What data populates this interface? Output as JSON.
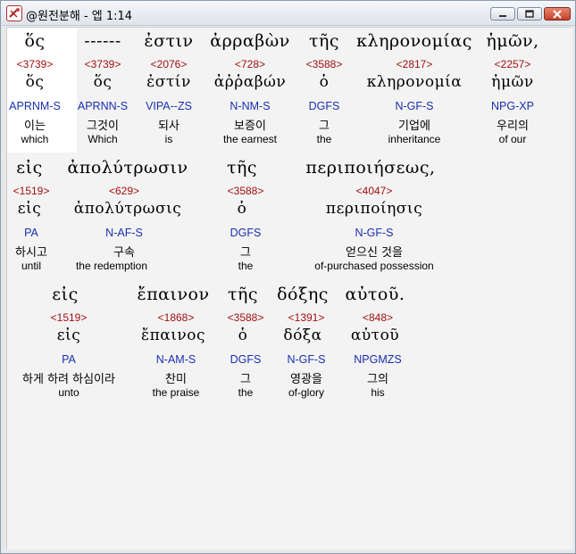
{
  "window": {
    "title": "@원전분해 - 엡 1:14"
  },
  "rows": [
    {
      "words": [
        {
          "greek": "ὅς",
          "strong": "<3739>",
          "lemma": "ὅς",
          "parse": "APRNM-S",
          "korean": "이는",
          "english": "which"
        },
        {
          "greek": "------",
          "strong": "<3739>",
          "lemma": "ὅς",
          "parse": "APRNN-S",
          "korean": "그것이",
          "english": "Which"
        },
        {
          "greek": "ἐστιν",
          "strong": "<2076>",
          "lemma": "ἐστίν",
          "parse": "VIPA--ZS",
          "korean": "되사",
          "english": "is"
        },
        {
          "greek": "ἀρραβὼν",
          "strong": "<728>",
          "lemma": "ἀῤῥαβών",
          "parse": "N-NM-S",
          "korean": "보증이",
          "english": "the earnest"
        },
        {
          "greek": "τῆς",
          "strong": "<3588>",
          "lemma": "ὁ",
          "parse": "DGFS",
          "korean": "그",
          "english": "the"
        },
        {
          "greek": "κληρονομίας",
          "strong": "<2817>",
          "lemma": "κληρονομία",
          "parse": "N-GF-S",
          "korean": "기업에",
          "english": "inheritance"
        },
        {
          "greek": "ἡμῶν,",
          "strong": "<2257>",
          "lemma": "ἡμῶν",
          "parse": "NPG-XP",
          "korean": "우리의",
          "english": "of our"
        }
      ]
    },
    {
      "words": [
        {
          "greek": "εἰς",
          "strong": "<1519>",
          "lemma": "εἰς",
          "parse": "PA",
          "korean": "하시고",
          "english": "until"
        },
        {
          "greek": "ἀπολύτρωσιν",
          "strong": "<629>",
          "lemma": "ἀπολύτρωσις",
          "parse": "N-AF-S",
          "korean": "구속",
          "english": "the redemption"
        },
        {
          "greek": "τῆς",
          "strong": "<3588>",
          "lemma": "ὁ",
          "parse": "DGFS",
          "korean": "그",
          "english": "the"
        },
        {
          "greek": "περιποιήσεως,",
          "strong": "<4047>",
          "lemma": "περιποίησις",
          "parse": "N-GF-S",
          "korean": "얻으신 것을",
          "english": "of-purchased possession"
        }
      ]
    },
    {
      "words": [
        {
          "greek": "εἰς",
          "strong": "<1519>",
          "lemma": "εἰς",
          "parse": "PA",
          "korean": "하게 하려 하심이라",
          "english": "unto"
        },
        {
          "greek": "ἔπαινον",
          "strong": "<1868>",
          "lemma": "ἔπαινος",
          "parse": "N-AM-S",
          "korean": "찬미",
          "english": "the praise"
        },
        {
          "greek": "τῆς",
          "strong": "<3588>",
          "lemma": "ὁ",
          "parse": "DGFS",
          "korean": "그",
          "english": "the"
        },
        {
          "greek": "δόξης",
          "strong": "<1391>",
          "lemma": "δόξα",
          "parse": "N-GF-S",
          "korean": "영광을",
          "english": "of-glory"
        },
        {
          "greek": "αὐτοῦ.",
          "strong": "<848>",
          "lemma": "αὐτοῦ",
          "parse": "NPGMZS",
          "korean": "그의",
          "english": "his"
        }
      ]
    }
  ]
}
